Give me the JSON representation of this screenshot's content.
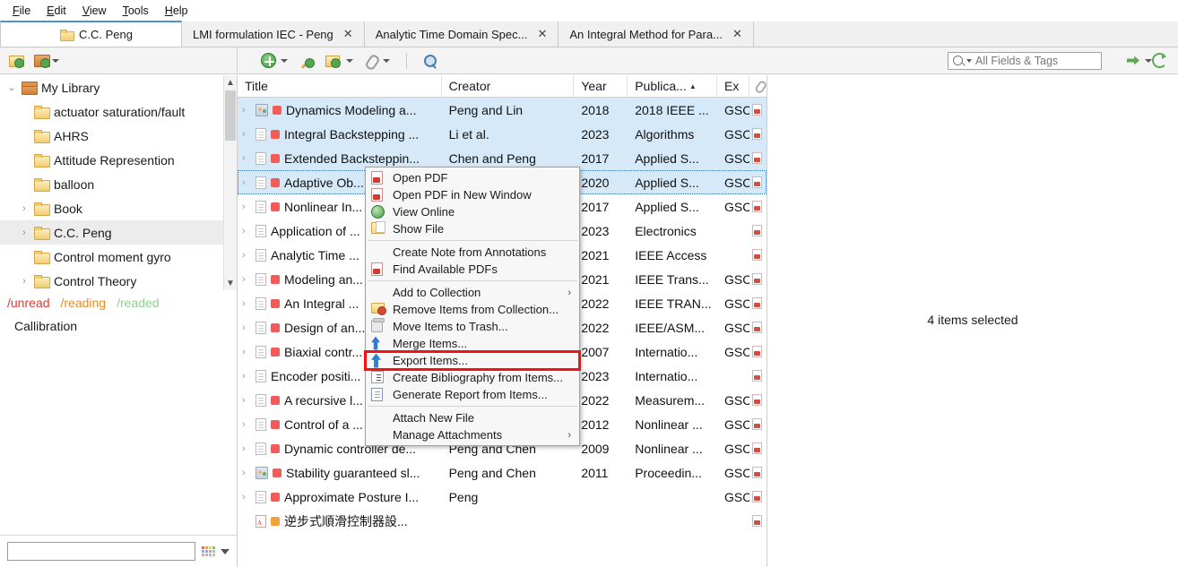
{
  "menubar": {
    "items": [
      {
        "label": "File",
        "accel": "F"
      },
      {
        "label": "Edit",
        "accel": "E"
      },
      {
        "label": "View",
        "accel": "V"
      },
      {
        "label": "Tools",
        "accel": "T"
      },
      {
        "label": "Help",
        "accel": "H"
      }
    ]
  },
  "tabs": [
    {
      "label": "C.C. Peng",
      "icon": "folder-icon",
      "active": true,
      "closable": false
    },
    {
      "label": "LMI formulation IEC - Peng",
      "active": false,
      "closable": true,
      "close": "✕"
    },
    {
      "label": "Analytic Time Domain Spec...",
      "active": false,
      "closable": true,
      "close": "✕"
    },
    {
      "label": "An Integral Method for Para...",
      "active": false,
      "closable": true,
      "close": "✕"
    }
  ],
  "toolbar": {
    "new_collection_icon": "new-collection-icon",
    "new_library_icon": "new-library-icon",
    "add_item_icon": "add-item-icon",
    "magic_wand_icon": "add-item-by-identifier-icon",
    "new_item_icon": "new-standalone-note-icon",
    "attachment_icon": "add-attachment-icon",
    "advanced_search_icon": "advanced-search-icon",
    "locate_icon": "locate-icon",
    "sync_icon": "sync-icon",
    "search": {
      "value": "",
      "placeholder": "All Fields & Tags",
      "mode_label": "All Fields & Tags"
    }
  },
  "sidebar": {
    "library": {
      "label": "My Library",
      "twisty": "⌄",
      "icon": "library-icon"
    },
    "collections": [
      {
        "label": "actuator saturation/fault",
        "twisty": "",
        "selected": false
      },
      {
        "label": "AHRS",
        "twisty": "",
        "selected": false
      },
      {
        "label": "Attitude Represention",
        "twisty": "",
        "selected": false
      },
      {
        "label": "balloon",
        "twisty": "",
        "selected": false
      },
      {
        "label": "Book",
        "twisty": "›",
        "selected": false
      },
      {
        "label": "C.C. Peng",
        "twisty": "›",
        "selected": true
      },
      {
        "label": "Control moment gyro",
        "twisty": "",
        "selected": false
      },
      {
        "label": "Control Theory",
        "twisty": "›",
        "selected": false
      }
    ],
    "saved_searches": [
      {
        "label": "/unread",
        "color": "#e3382f"
      },
      {
        "label": "/reading",
        "color": "#ef8a1e"
      },
      {
        "label": "/readed",
        "color": "#8fd08f"
      }
    ],
    "extra_item": {
      "label": "Callibration"
    },
    "tag_selector": {
      "filter_value": "",
      "filter_placeholder": "",
      "color_picker_icon": "tag-color-grid-icon",
      "dropdown_icon": "chevron-down-icon",
      "swatches": [
        "#e8635a",
        "#f0a33c",
        "#f0d23c",
        "#7fc27f",
        "#7fb8e0",
        "#b98fd8",
        "#e08fc0",
        "#9ec8a0",
        "#e8a2a2",
        "#b0b0e0",
        "#8fd0c8",
        "#d8c08f"
      ]
    }
  },
  "items_table": {
    "columns": [
      {
        "key": "title",
        "label": "Title",
        "sorted": false
      },
      {
        "key": "creator",
        "label": "Creator",
        "sorted": false
      },
      {
        "key": "year",
        "label": "Year",
        "sorted": false
      },
      {
        "key": "publication",
        "label": "Publica...",
        "sorted": true,
        "sort_arrow": "▲"
      },
      {
        "key": "extra",
        "label": "Ex",
        "sorted": false
      },
      {
        "key": "attachment",
        "label": "",
        "icon": "paperclip-icon"
      }
    ],
    "rows": [
      {
        "twisty": "›",
        "type_icon": "conference-paper-icon",
        "dot": "#f05c58",
        "title": "Dynamics Modeling a...",
        "creator": "Peng and Lin",
        "year": "2018",
        "publication": "2018 IEEE ...",
        "extra": "GSC",
        "attachment": "pdf-icon",
        "selected": true
      },
      {
        "twisty": "›",
        "type_icon": "journal-article-icon",
        "dot": "#f05c58",
        "title": "Integral Backstepping ...",
        "creator": "Li et al.",
        "year": "2023",
        "publication": "Algorithms",
        "extra": "GSC",
        "attachment": "pdf-icon",
        "selected": true,
        "twisty_blue": true
      },
      {
        "twisty": "›",
        "type_icon": "journal-article-icon",
        "dot": "#f05c58",
        "title": "Extended Backsteppin...",
        "creator": "Chen and Peng",
        "year": "2017",
        "publication": "Applied S...",
        "extra": "GSC",
        "attachment": "pdf-icon",
        "selected": true
      },
      {
        "twisty": "›",
        "type_icon": "journal-article-icon",
        "dot": "#f05c58",
        "title": "Adaptive Ob...",
        "creator": "",
        "year": "2020",
        "publication": "Applied S...",
        "extra": "GSC",
        "attachment": "pdf-icon",
        "selected": true,
        "focused": true
      },
      {
        "twisty": "›",
        "type_icon": "journal-article-icon",
        "dot": "#f05c58",
        "title": "Nonlinear In...",
        "creator": "",
        "year": "2017",
        "publication": "Applied S...",
        "extra": "GSC",
        "attachment": "pdf-icon",
        "selected": false
      },
      {
        "twisty": "›",
        "type_icon": "journal-article-icon",
        "dot": "",
        "title": "Application of ...",
        "creator": "",
        "year": "2023",
        "publication": "Electronics",
        "extra": "",
        "attachment": "pdf-icon",
        "selected": false
      },
      {
        "twisty": "›",
        "type_icon": "journal-article-icon",
        "dot": "",
        "title": "Analytic Time ...",
        "creator": "",
        "year": "2021",
        "publication": "IEEE Access",
        "extra": "",
        "attachment": "pdf-icon",
        "selected": false
      },
      {
        "twisty": "›",
        "type_icon": "journal-article-icon",
        "dot": "#f05c58",
        "title": "Modeling an...",
        "creator": "",
        "year": "2021",
        "publication": "IEEE Trans...",
        "extra": "GSC",
        "attachment": "pdf-icon",
        "selected": false
      },
      {
        "twisty": "›",
        "type_icon": "journal-article-icon",
        "dot": "#f05c58",
        "title": "An Integral ...",
        "creator": "",
        "year": "2022",
        "publication": "IEEE TRAN...",
        "extra": "GSC",
        "attachment": "pdf-icon",
        "selected": false
      },
      {
        "twisty": "›",
        "type_icon": "journal-article-icon",
        "dot": "#f05c58",
        "title": "Design of an...",
        "creator": "",
        "year": "2022",
        "publication": "IEEE/ASM...",
        "extra": "GSC",
        "attachment": "pdf-icon",
        "selected": false
      },
      {
        "twisty": "›",
        "type_icon": "journal-article-icon",
        "dot": "#f05c58",
        "title": "Biaxial contr...",
        "creator": "",
        "year": "2007",
        "publication": "Internatio...",
        "extra": "GSC",
        "attachment": "pdf-icon",
        "selected": false
      },
      {
        "twisty": "›",
        "type_icon": "journal-article-icon",
        "dot": "",
        "title": "Encoder positi...",
        "creator": "",
        "year": "2023",
        "publication": "Internatio...",
        "extra": "",
        "attachment": "pdf-icon",
        "selected": false
      },
      {
        "twisty": "›",
        "type_icon": "journal-article-icon",
        "dot": "#f05c58",
        "title": "A recursive l...",
        "creator": "",
        "year": "2022",
        "publication": "Measurem...",
        "extra": "GSC",
        "attachment": "pdf-icon",
        "selected": false
      },
      {
        "twisty": "›",
        "type_icon": "journal-article-icon",
        "dot": "#f05c58",
        "title": "Control of a ...",
        "creator": "",
        "year": "2012",
        "publication": "Nonlinear ...",
        "extra": "GSC",
        "attachment": "pdf-icon",
        "selected": false
      },
      {
        "twisty": "›",
        "type_icon": "journal-article-icon",
        "dot": "#f05c58",
        "title": "Dynamic controller de...",
        "creator": "Peng and Chen",
        "year": "2009",
        "publication": "Nonlinear ...",
        "extra": "GSC",
        "attachment": "pdf-icon",
        "selected": false
      },
      {
        "twisty": "›",
        "type_icon": "conference-paper-icon",
        "dot": "#f05c58",
        "title": "Stability guaranteed sl...",
        "creator": "Peng and Chen",
        "year": "2011",
        "publication": "Proceedin...",
        "extra": "GSC",
        "attachment": "pdf-icon",
        "selected": false
      },
      {
        "twisty": "›",
        "type_icon": "journal-article-icon",
        "dot": "#f05c58",
        "title": "Approximate Posture I...",
        "creator": "Peng",
        "year": "",
        "publication": "",
        "extra": "GSC",
        "attachment": "pdf-icon",
        "selected": false
      },
      {
        "twisty": "",
        "type_icon": "pdf-attachment-icon",
        "dot": "#f0a33c",
        "title": "逆步式順滑控制器設...",
        "creator": "",
        "year": "",
        "publication": "",
        "extra": "",
        "attachment": "pdf-icon",
        "selected": false
      }
    ]
  },
  "context_menu": {
    "groups": [
      [
        {
          "label": "Open PDF",
          "icon": "pdf-icon",
          "highlighted": false
        },
        {
          "label": "Open PDF in New Window",
          "icon": "pdf-icon",
          "highlighted": false
        },
        {
          "label": "View Online",
          "icon": "globe-icon",
          "highlighted": false
        },
        {
          "label": "Show File",
          "icon": "show-file-icon",
          "highlighted": false
        }
      ],
      [
        {
          "label": "Create Note from Annotations",
          "icon": "",
          "highlighted": false
        },
        {
          "label": "Find Available PDFs",
          "icon": "pdf-icon",
          "highlighted": false
        }
      ],
      [
        {
          "label": "Add to Collection",
          "icon": "",
          "submenu": true,
          "submenu_arrow": "›",
          "highlighted": false
        },
        {
          "label": "Remove Items from Collection...",
          "icon": "remove-from-collection-icon",
          "highlighted": false
        },
        {
          "label": "Move Items to Trash...",
          "icon": "trash-icon",
          "highlighted": false
        },
        {
          "label": "Merge Items...",
          "icon": "merge-icon",
          "highlighted": false
        },
        {
          "label": "Export Items...",
          "icon": "export-icon",
          "highlighted": true
        },
        {
          "label": "Create Bibliography from Items...",
          "icon": "bibliography-icon",
          "highlighted": false
        },
        {
          "label": "Generate Report from Items...",
          "icon": "report-icon",
          "highlighted": false
        }
      ],
      [
        {
          "label": "Attach New File",
          "icon": "",
          "highlighted": false
        },
        {
          "label": "Manage Attachments",
          "icon": "",
          "submenu": true,
          "submenu_arrow": "›",
          "highlighted": false
        }
      ]
    ],
    "highlight_color": "#f21414"
  },
  "right_pane": {
    "status": "4 items selected"
  },
  "colors": {
    "selection_blue": "#d6e9f8",
    "tab_active_top": "#4a90d9",
    "red_tag": "#f05c58",
    "orange_tag": "#f0a33c"
  }
}
